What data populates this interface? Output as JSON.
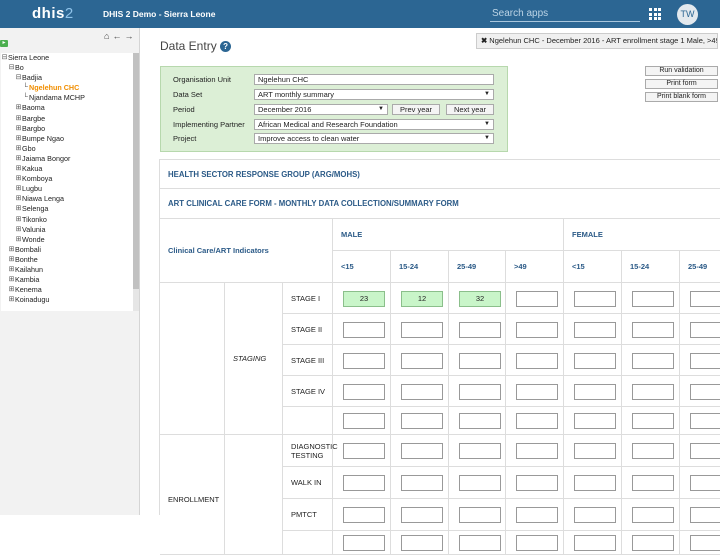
{
  "topbar": {
    "logo": "dhis",
    "logo_num": "2",
    "app_title": "DHIS 2 Demo - Sierra Leone",
    "search_placeholder": "Search apps",
    "avatar": "TW"
  },
  "tree": {
    "items": [
      {
        "glyph": "⊟",
        "label": "Sierra Leone"
      },
      {
        "glyph": "⊟",
        "label": "Bo"
      },
      {
        "glyph": "⊟",
        "label": "Badjia"
      },
      {
        "glyph": "└",
        "label": "Ngelehun CHC"
      },
      {
        "glyph": "└",
        "label": "Njandama MCHP"
      },
      {
        "glyph": "⊞",
        "label": "Baoma"
      },
      {
        "glyph": "⊞",
        "label": "Bargbe"
      },
      {
        "glyph": "⊞",
        "label": "Bargbo"
      },
      {
        "glyph": "⊞",
        "label": "Bumpe Ngao"
      },
      {
        "glyph": "⊞",
        "label": "Gbo"
      },
      {
        "glyph": "⊞",
        "label": "Jaiama Bongor"
      },
      {
        "glyph": "⊞",
        "label": "Kakua"
      },
      {
        "glyph": "⊞",
        "label": "Komboya"
      },
      {
        "glyph": "⊞",
        "label": "Lugbu"
      },
      {
        "glyph": "⊞",
        "label": "Niawa Lenga"
      },
      {
        "glyph": "⊞",
        "label": "Selenga"
      },
      {
        "glyph": "⊞",
        "label": "Tikonko"
      },
      {
        "glyph": "⊞",
        "label": "Valunia"
      },
      {
        "glyph": "⊞",
        "label": "Wonde"
      },
      {
        "glyph": "⊞",
        "label": "Bombali"
      },
      {
        "glyph": "⊞",
        "label": "Bonthe"
      },
      {
        "glyph": "⊞",
        "label": "Kailahun"
      },
      {
        "glyph": "⊞",
        "label": "Kambia"
      },
      {
        "glyph": "⊞",
        "label": "Kenema"
      },
      {
        "glyph": "⊞",
        "label": "Koinadugu"
      }
    ]
  },
  "main": {
    "title": "Data Entry",
    "help": "?",
    "context_banner": "Ngelehun CHC - December 2016 - ART enrollment stage 1 Male, >49y"
  },
  "form": {
    "org_unit_label": "Organisation Unit",
    "org_unit_value": "Ngelehun CHC",
    "dataset_label": "Data Set",
    "dataset_value": "ART monthly summary",
    "period_label": "Period",
    "period_value": "December 2016",
    "prev_year": "Prev year",
    "next_year": "Next year",
    "partner_label": "Implementing Partner",
    "partner_value": "African Medical and Research Foundation",
    "project_label": "Project",
    "project_value": "Improve access to clean water"
  },
  "actions": {
    "run_validation": "Run validation",
    "print_form": "Print form",
    "print_blank_form": "Print blank form"
  },
  "table": {
    "section1": "HEALTH SECTOR RESPONSE GROUP (ARG/MOHS)",
    "section2": "ART CLINICAL CARE FORM - MONTHLY DATA COLLECTION/SUMMARY FORM",
    "header_indicators": "Clinical Care/ART Indicators",
    "male": "MALE",
    "female": "FEMALE",
    "age_groups": [
      "<15",
      "15-24",
      "25-49",
      ">49",
      "<15",
      "15-24",
      "25-49"
    ],
    "group_staging": "STAGING",
    "group_enrollment": "ENROLLMENT",
    "stages": [
      "STAGE I",
      "STAGE II",
      "STAGE III",
      "STAGE IV"
    ],
    "enrollment_rows": [
      "DIAGNOSTIC TESTING",
      "WALK IN",
      "PMTCT"
    ],
    "stage1_values": [
      "23",
      "12",
      "32"
    ]
  }
}
